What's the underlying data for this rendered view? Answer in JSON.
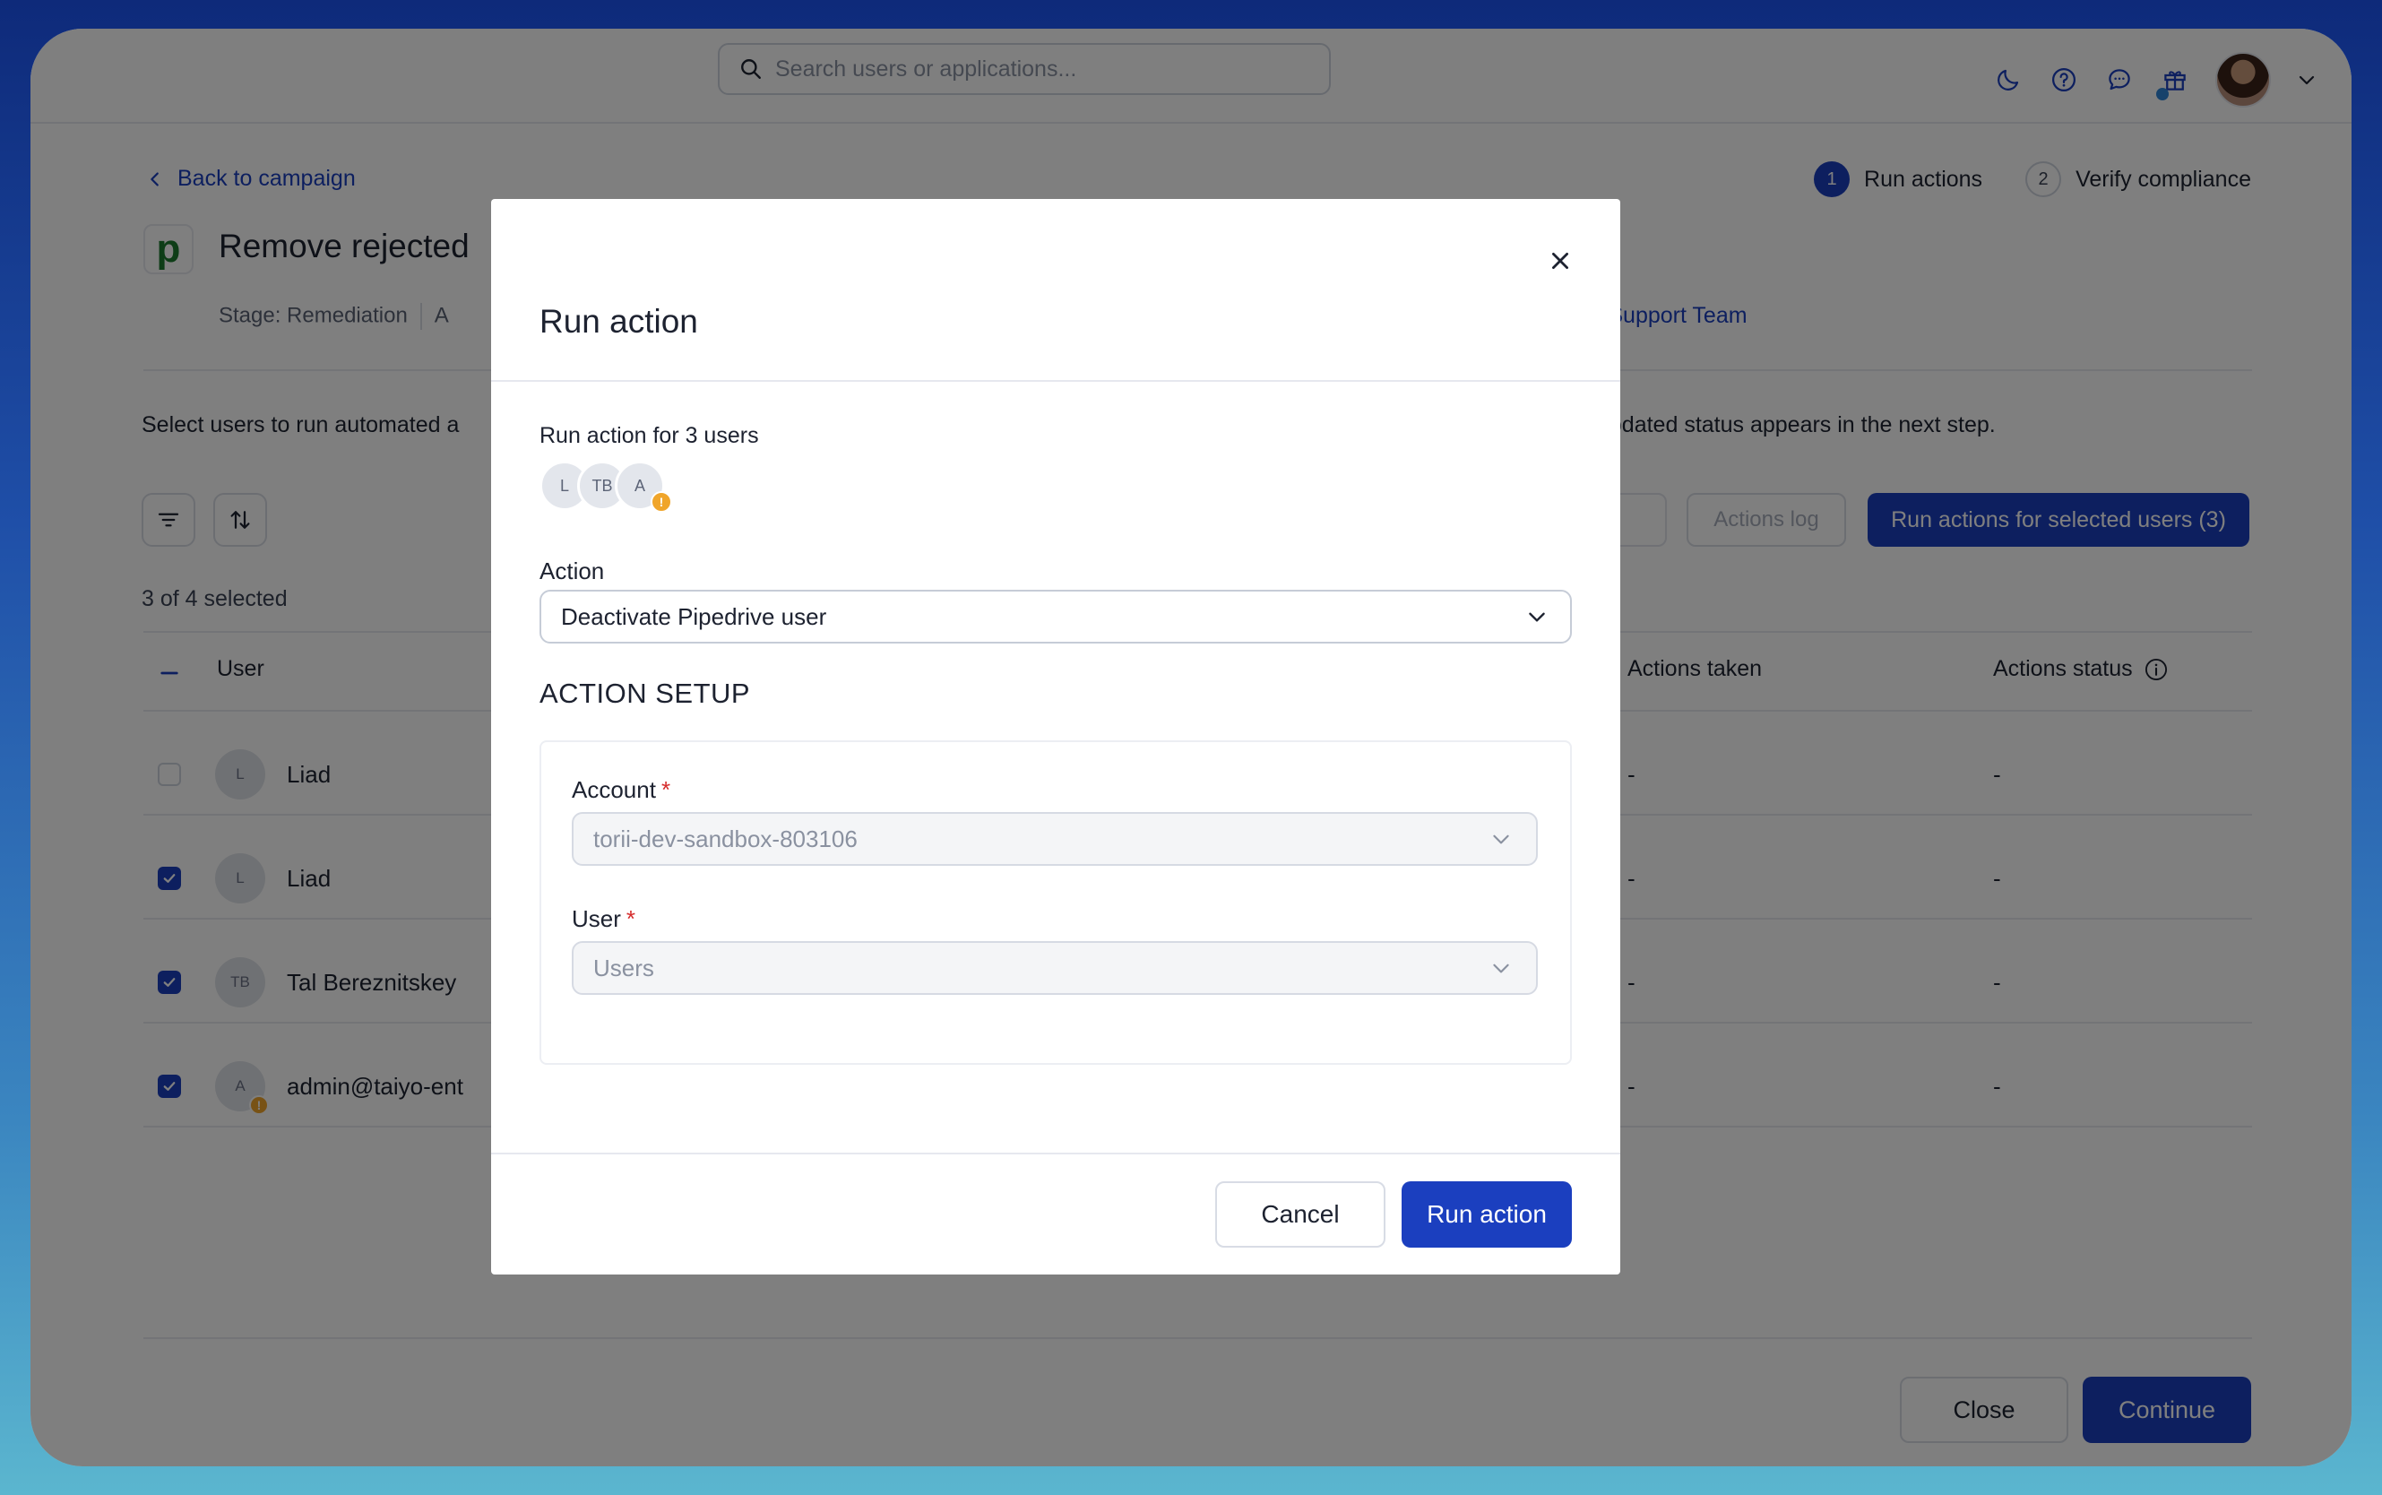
{
  "search": {
    "placeholder": "Search users or applications..."
  },
  "nav": {
    "back_label": "Back to campaign"
  },
  "steps": [
    {
      "num": "1",
      "label": "Run actions"
    },
    {
      "num": "2",
      "label": "Verify compliance"
    }
  ],
  "page": {
    "app_logo_letter": "p",
    "title": "Remove rejected",
    "stage": "Stage: Remediation",
    "stage_cont": "A",
    "owner_partial": "rii Support Team",
    "intro_left": "Select users to run automated a",
    "intro_right": "updated status appears in the next step.",
    "selected_count": "3 of 4 selected"
  },
  "toolbar": {
    "actions_log": "Actions log",
    "run_selected": "Run actions for selected users (3)"
  },
  "table": {
    "columns": {
      "user": "User",
      "actions_taken": "Actions taken",
      "actions_status": "Actions status"
    },
    "rows": [
      {
        "initials": "L",
        "name": "Liad",
        "checked": false,
        "warning": false,
        "actions_taken": "-",
        "actions_status": "-"
      },
      {
        "initials": "L",
        "name": "Liad",
        "checked": true,
        "warning": false,
        "actions_taken": "-",
        "actions_status": "-"
      },
      {
        "initials": "TB",
        "name": "Tal Bereznitskey",
        "checked": true,
        "warning": false,
        "actions_taken": "-",
        "actions_status": "-"
      },
      {
        "initials": "A",
        "name": "admin@taiyo-ent",
        "checked": true,
        "warning": true,
        "actions_taken": "-",
        "actions_status": "-"
      }
    ]
  },
  "footer": {
    "close": "Close",
    "continue": "Continue"
  },
  "modal": {
    "title": "Run action",
    "subtitle": "Run action for 3 users",
    "avatars": [
      "L",
      "TB",
      "A"
    ],
    "warning_glyph": "!",
    "action_label": "Action",
    "action_value": "Deactivate Pipedrive user",
    "section_title": "ACTION SETUP",
    "account_label": "Account",
    "account_value": "torii-dev-sandbox-803106",
    "user_label": "User",
    "user_placeholder": "Users",
    "required_mark": "*",
    "cancel": "Cancel",
    "run": "Run action"
  },
  "colors": {
    "primary": "#1b3fbf",
    "warning": "#f0a52a",
    "required": "#d52b2b"
  },
  "icons": [
    "search-icon",
    "moon-icon",
    "help-icon",
    "chat-icon",
    "gift-icon",
    "chevron-down-icon",
    "chevron-left-icon",
    "filter-icon",
    "sort-icon",
    "info-icon",
    "close-icon",
    "check-icon"
  ]
}
